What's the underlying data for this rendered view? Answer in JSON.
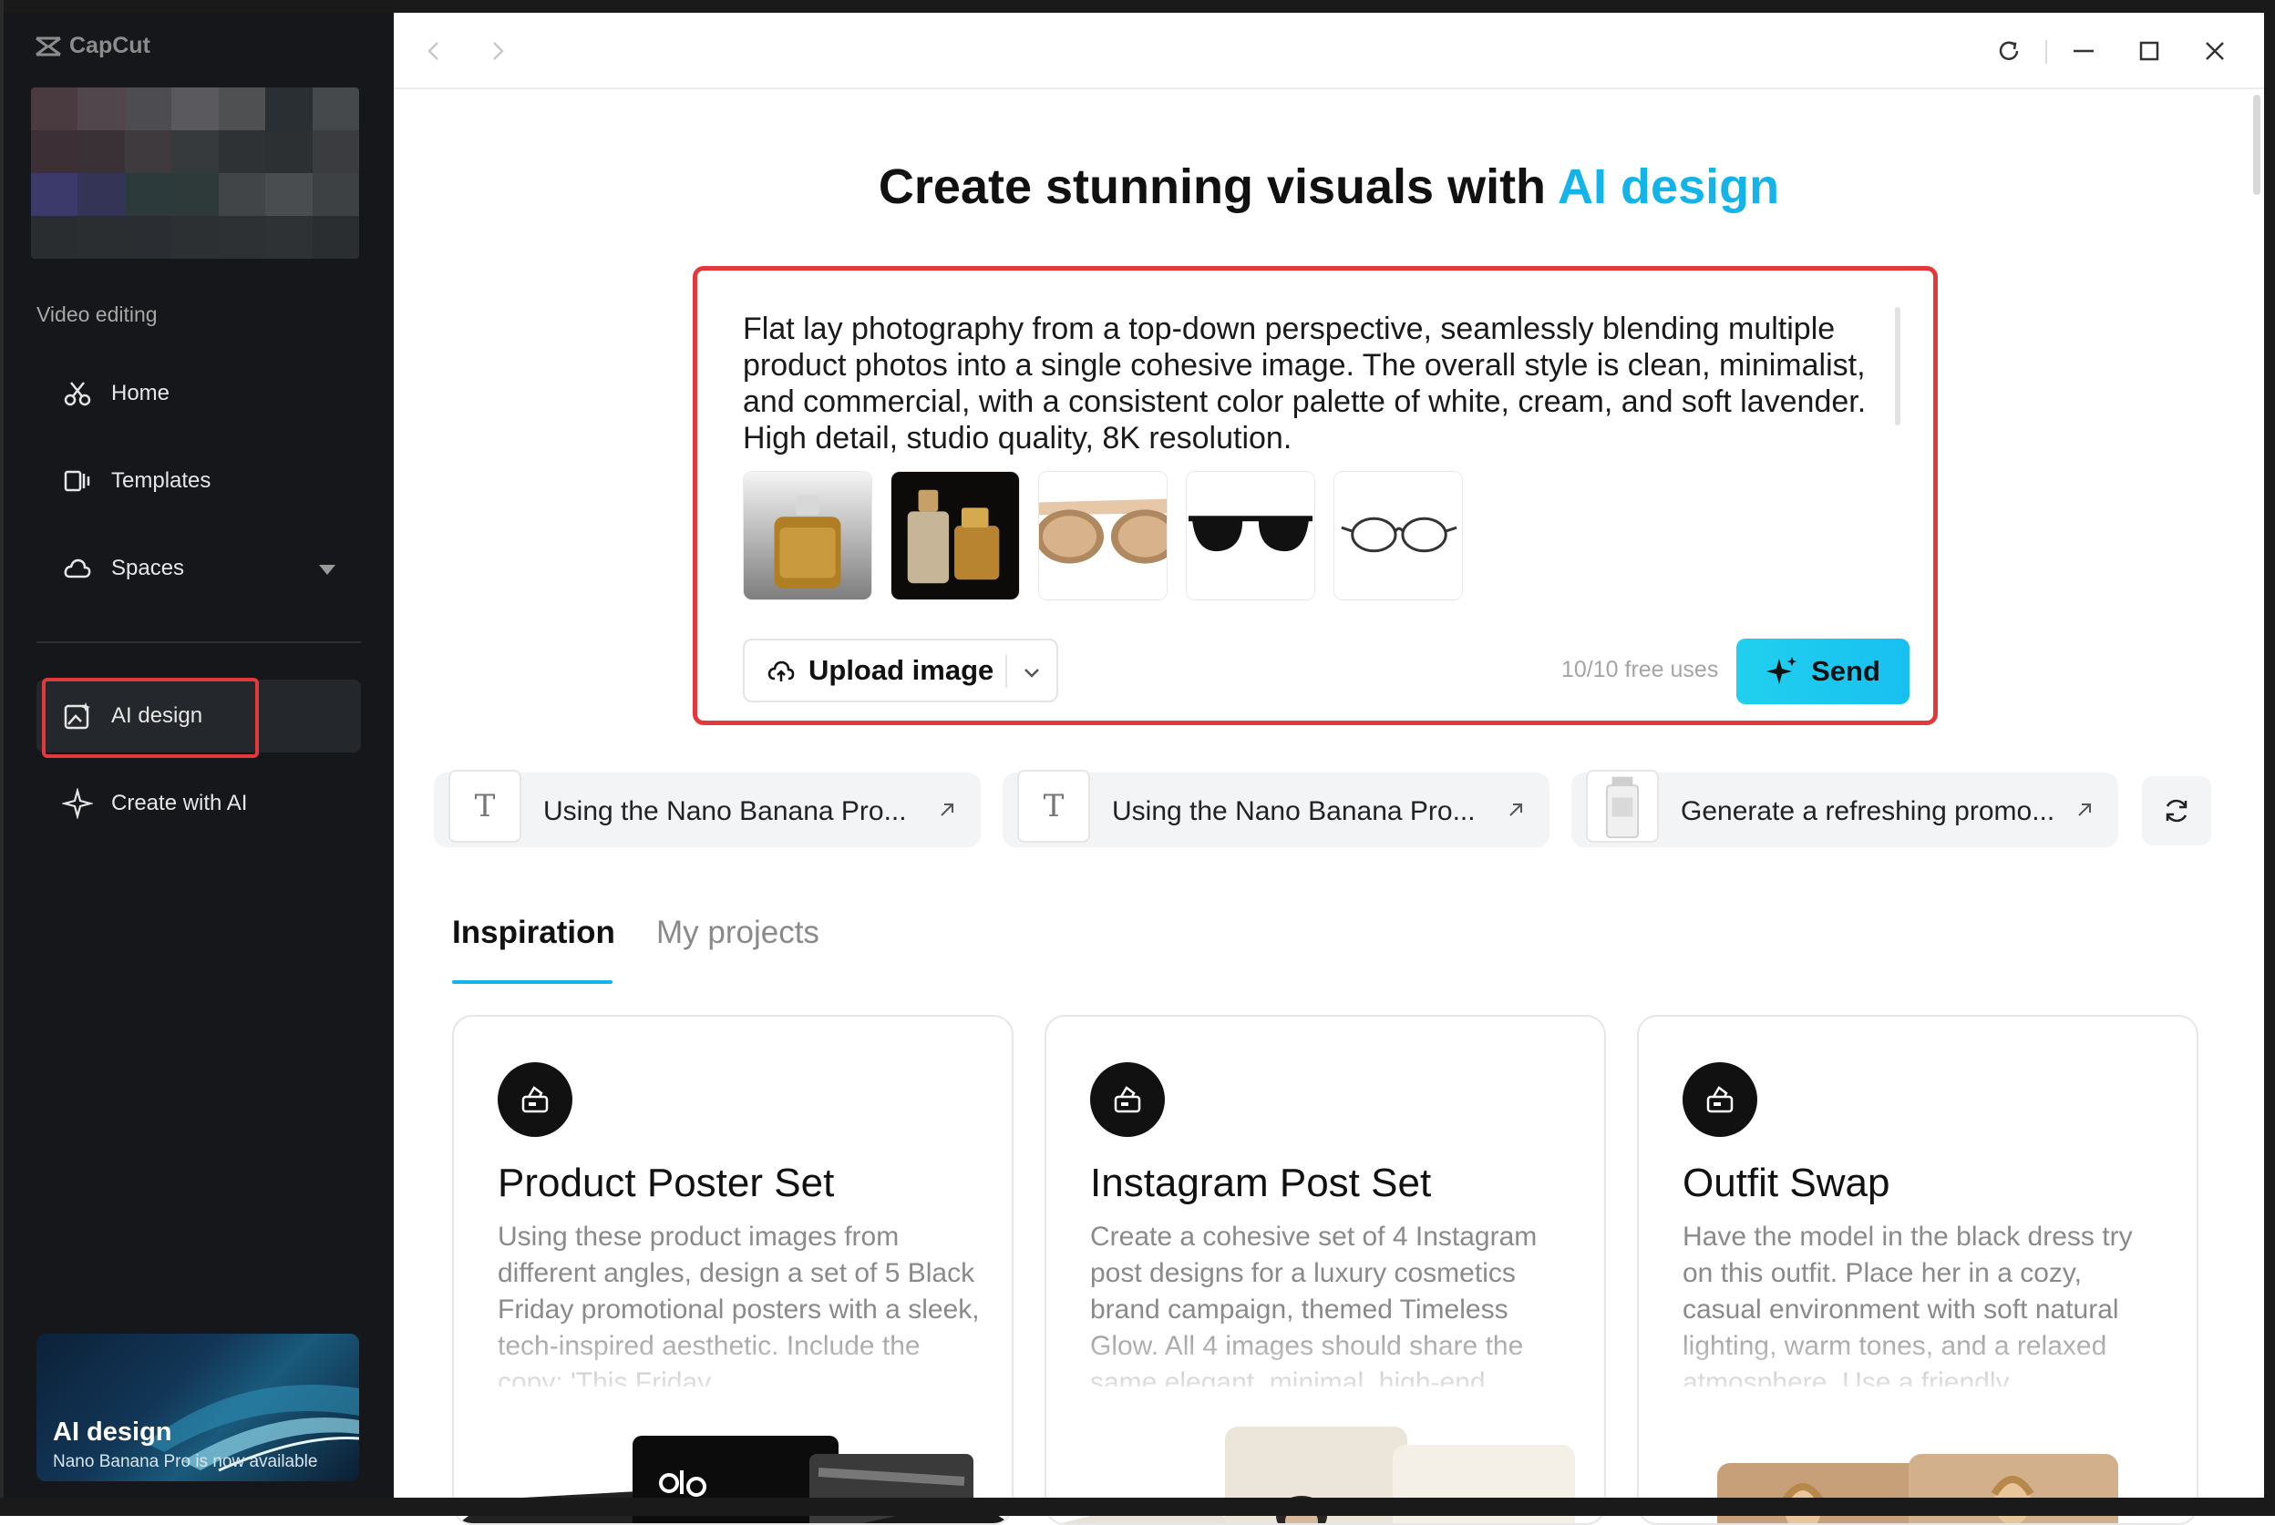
{
  "app": {
    "name": "CapCut"
  },
  "sidebar": {
    "section_label": "Video editing",
    "items": [
      {
        "label": "Home",
        "icon": "scissors-icon"
      },
      {
        "label": "Templates",
        "icon": "templates-icon"
      },
      {
        "label": "Spaces",
        "icon": "cloud-icon"
      },
      {
        "label": "AI design",
        "icon": "ai-image-icon",
        "active": true
      },
      {
        "label": "Create with AI",
        "icon": "sparkle-icon"
      }
    ],
    "promo": {
      "title": "AI design",
      "subtitle": "Nano Banana Pro is now available"
    }
  },
  "main": {
    "headline": {
      "text": "Create stunning visuals with ",
      "accent": "AI design"
    },
    "prompt": {
      "text": "Flat lay photography from a top-down perspective, seamlessly blending multiple product photos into a single cohesive image. The overall style is clean, minimalist, and commercial, with a consistent color palette of white, cream, and soft lavender. High detail, studio quality, 8K resolution.",
      "images": [
        "perfume-bottle-gold",
        "perfume-bottle-dark",
        "sunglasses-tan",
        "sunglasses-black",
        "eyeglasses-clear"
      ],
      "upload_label": "Upload image",
      "free_uses": "10/10 free uses",
      "send_label": "Send"
    },
    "suggestions": [
      {
        "text": "Using the Nano Banana Pro..."
      },
      {
        "text": "Using the Nano Banana Pro..."
      },
      {
        "text": "Generate a refreshing promo..."
      }
    ],
    "tabs": [
      {
        "label": "Inspiration",
        "active": true
      },
      {
        "label": "My projects",
        "active": false
      }
    ],
    "cards": [
      {
        "title": "Product Poster Set",
        "desc": "Using these product images from different angles, design a set of 5 Black Friday promotional posters with a sleek, tech-inspired aesthetic. Include the copy: 'This Friday,"
      },
      {
        "title": "Instagram Post Set",
        "desc": "Create a cohesive set of 4 Instagram post designs for a luxury cosmetics brand campaign, themed Timeless Glow. All 4 images should share the same elegant, minimal, high-end"
      },
      {
        "title": "Outfit Swap",
        "desc": "Have the model in the black dress try on this outfit. Place her in a cozy, casual environment with soft natural lighting, warm tones, and a relaxed atmosphere. Use a friendly,"
      }
    ]
  },
  "colors": {
    "accent": "#14b4e8",
    "highlight": "#e4393c",
    "sidebar_bg": "#15171a",
    "send_bg": "#21d0ee"
  }
}
